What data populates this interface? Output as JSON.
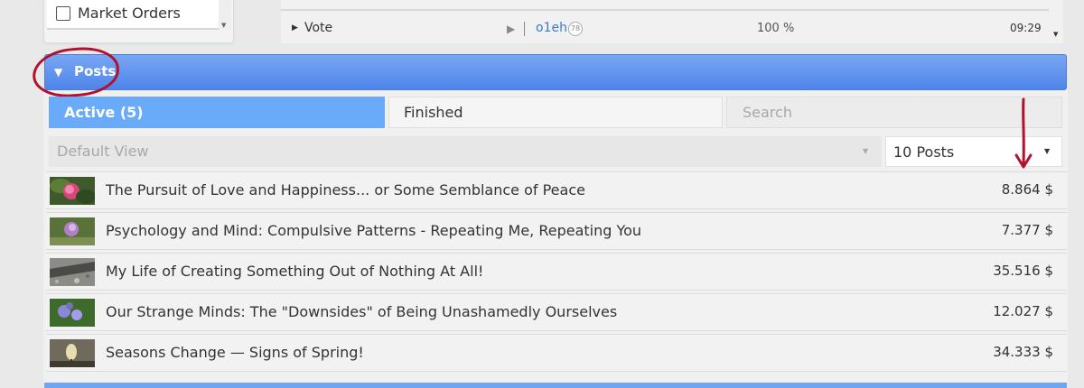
{
  "market": {
    "checkbox_label": "Market Orders"
  },
  "vote_row": {
    "label": "Vote",
    "user": "o1eh",
    "reputation": "78",
    "percent": "100 %",
    "time": "09:29"
  },
  "posts_panel": {
    "title": "Posts",
    "tabs": {
      "active": "Active (5)",
      "finished": "Finished"
    },
    "search_placeholder": "Search",
    "view_select": "Default View",
    "count_select": "10 Posts",
    "items": [
      {
        "title": "The Pursuit of Love and Happiness... or Some Semblance of Peace",
        "value": "8.864 $",
        "thumb": "pink-flower"
      },
      {
        "title": "Psychology and Mind: Compulsive Patterns - Repeating Me, Repeating You",
        "value": "7.377 $",
        "thumb": "clover-flower"
      },
      {
        "title": "My Life of Creating Something Out of Nothing At All!",
        "value": "35.516 $",
        "thumb": "gravel-stones"
      },
      {
        "title": "Our Strange Minds: The \"Downsides\" of Being Unashamedly Ourselves",
        "value": "12.027 $",
        "thumb": "purple-flowers"
      },
      {
        "title": "Seasons Change — Signs of Spring!",
        "value": "34.333 $",
        "thumb": "spring-bud"
      }
    ]
  },
  "annotation_color": "#b3102b",
  "accent_color": "#4f85ea"
}
